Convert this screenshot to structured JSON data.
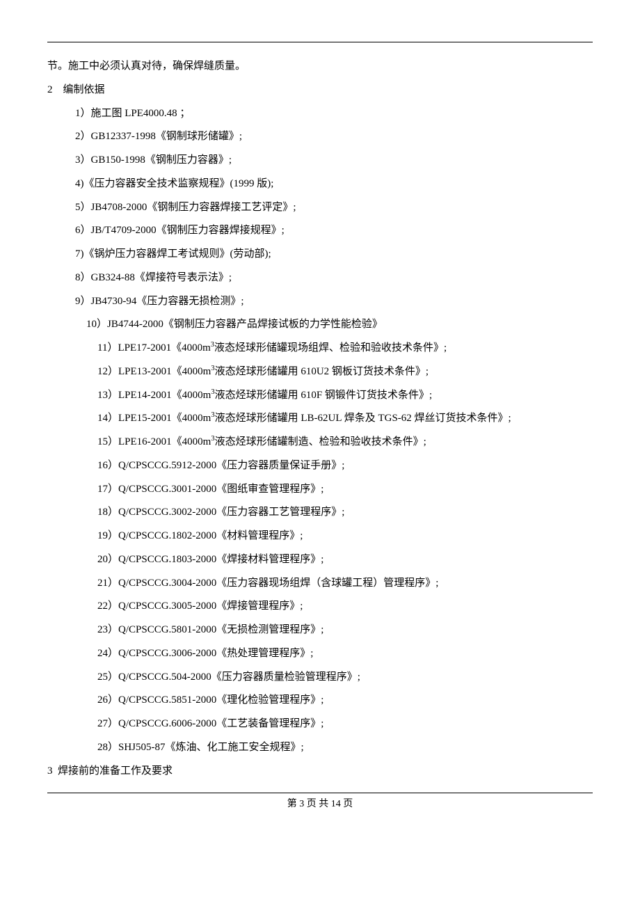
{
  "body": {
    "opening": "节。施工中必须认真对待，确保焊缝质量。",
    "section2_head": "2    编制依据",
    "items": [
      "1）施工图 LPE4000.48 ；",
      "2）GB12337-1998《钢制球形储罐》;",
      "3）GB150-1998《钢制压力容器》;",
      "4)《压力容器安全技术监察规程》(1999 版);",
      "5）JB4708-2000《钢制压力容器焊接工艺评定》;",
      "6）JB/T4709-2000《钢制压力容器焊接规程》;",
      "7)《锅炉压力容器焊工考试规则》(劳动部);",
      "8）GB324-88《焊接符号表示法》;",
      "9）JB4730-94《压力容器无损检测》;"
    ],
    "item10": "10）JB4744-2000《钢制压力容器产品焊接试板的力学性能检验》",
    "items2": [
      {
        "pre": "11）LPE17-2001《4000m",
        "post": "液态烃球形储罐现场组焊、检验和验收技术条件》;"
      },
      {
        "pre": "12）LPE13-2001《4000m",
        "post": "液态烃球形储罐用 610U2 钢板订货技术条件》;"
      },
      {
        "pre": "13）LPE14-2001《4000m",
        "post": "液态烃球形储罐用 610F 钢锻件订货技术条件》;"
      },
      {
        "pre": "14）LPE15-2001《4000m",
        "post": "液态烃球形储罐用 LB-62UL 焊条及 TGS-62 焊丝订货技术条件》;"
      },
      {
        "pre": "15）LPE16-2001《4000m",
        "post": "液态烃球形储罐制造、检验和验收技术条件》;"
      }
    ],
    "items3": [
      "16）Q/CPSCCG.5912-2000《压力容器质量保证手册》;",
      "17）Q/CPSCCG.3001-2000《图纸审查管理程序》;",
      "18）Q/CPSCCG.3002-2000《压力容器工艺管理程序》;",
      "19）Q/CPSCCG.1802-2000《材料管理程序》;",
      "20）Q/CPSCCG.1803-2000《焊接材料管理程序》;",
      "21）Q/CPSCCG.3004-2000《压力容器现场组焊（含球罐工程）管理程序》;",
      "22）Q/CPSCCG.3005-2000《焊接管理程序》;",
      "23）Q/CPSCCG.5801-2000《无损检测管理程序》;",
      "24）Q/CPSCCG.3006-2000《热处理管理程序》;",
      "25）Q/CPSCCG.504-2000《压力容器质量检验管理程序》;",
      "26）Q/CPSCCG.5851-2000《理化检验管理程序》;",
      "27）Q/CPSCCG.6006-2000《工艺装备管理程序》;",
      "28）SHJ505-87《炼油、化工施工安全规程》;"
    ],
    "section3_head": "3  焊接前的准备工作及要求"
  },
  "footer": "第 3 页 共 14 页"
}
